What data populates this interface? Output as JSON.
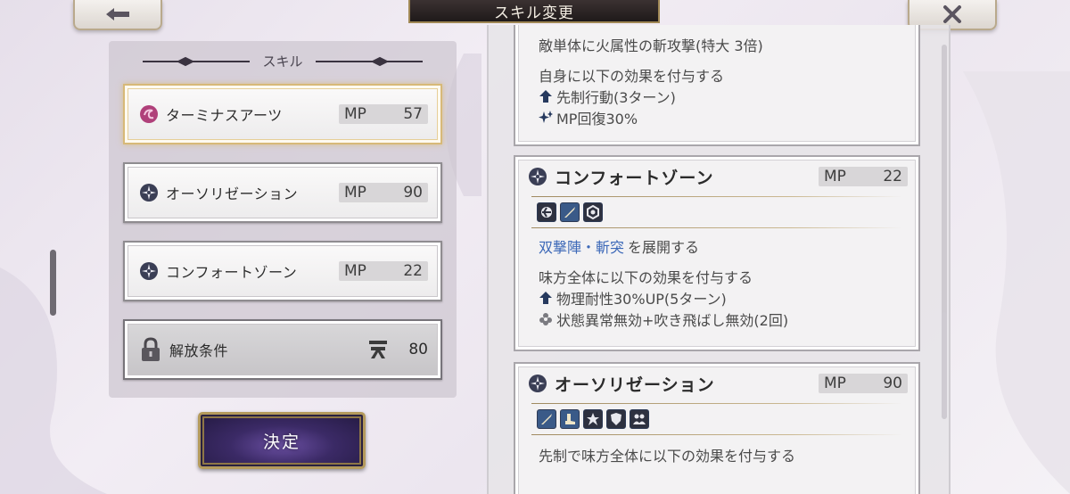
{
  "header": {
    "title": "スキル変更",
    "back_icon": "back-arrow-icon",
    "close_icon": "close-x-icon"
  },
  "skill_list": {
    "heading": "スキル",
    "items": [
      {
        "name": "ターミナスアーツ",
        "mp_label": "MP",
        "mp": "57",
        "icon": "swirl-orb-icon",
        "selected": true
      },
      {
        "name": "オーソリゼーション",
        "mp_label": "MP",
        "mp": "90",
        "icon": "gear-emblem-icon",
        "selected": false
      },
      {
        "name": "コンフォートゾーン",
        "mp_label": "MP",
        "mp": "22",
        "icon": "gear-emblem-icon",
        "selected": false
      }
    ],
    "locked": {
      "label": "解放条件",
      "value": "80",
      "icon": "padlock-icon",
      "req_icon": "sky-kanji-icon"
    }
  },
  "confirm_label": "決定",
  "details": {
    "card1": {
      "partial_line": "敵単体に火属性の斬攻撃(特大 3倍)",
      "line1": "自身に以下の効果を付与する",
      "effect1": "先制行動(3ターン)",
      "effect2": "MP回復30%"
    },
    "card2": {
      "title": "コンフォートゾーン",
      "mp_label": "MP",
      "mp": "22",
      "link": "双撃陣・斬突",
      "link_suffix": "を展開する",
      "line1": "味方全体に以下の効果を付与する",
      "effect1": "物理耐性30%UP(5ターン)",
      "effect2": "状態異常無効+吹き飛ばし無効(2回)"
    },
    "card3": {
      "title": "オーソリゼーション",
      "mp_label": "MP",
      "mp": "90",
      "line1": "先制で味方全体に以下の効果を付与する"
    }
  },
  "colors": {
    "accent_gold": "#d7b978",
    "link_blue": "#3d69b8",
    "confirm_purple": "#3b2a66"
  }
}
